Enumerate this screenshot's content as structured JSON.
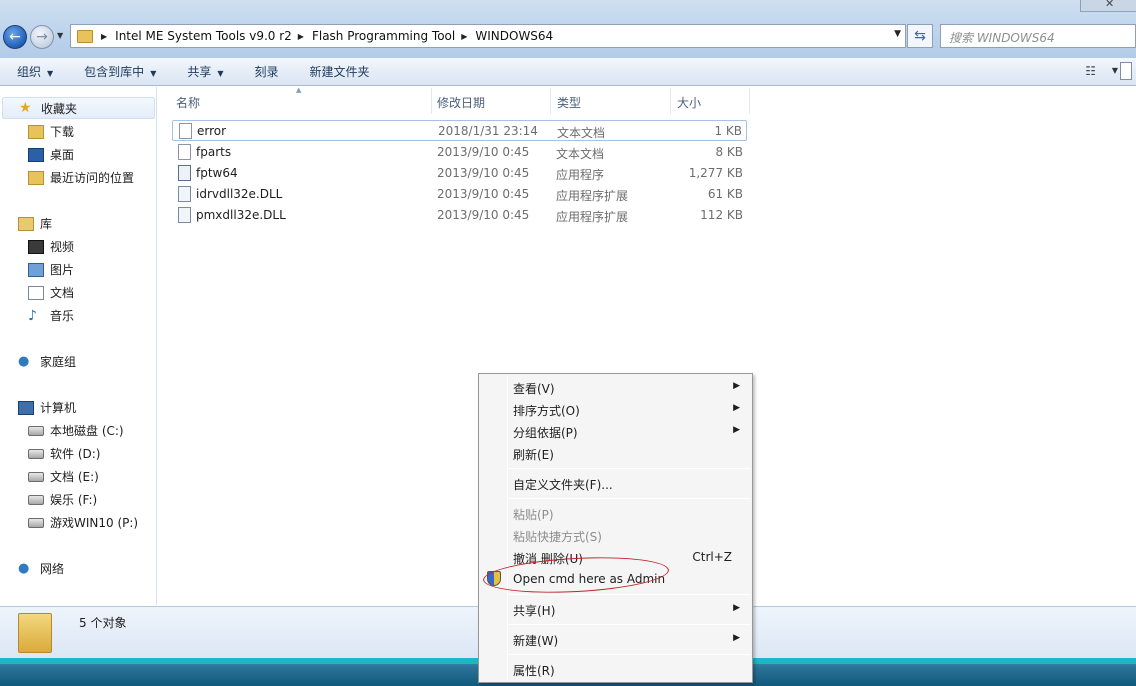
{
  "address": {
    "crumbs": [
      "Intel ME System Tools v9.0 r2",
      "Flash Programming Tool",
      "WINDOWS64"
    ],
    "search_placeholder": "搜索 WINDOWS64"
  },
  "toolbar": {
    "organize": "组织",
    "include_library": "包含到库中",
    "share": "共享",
    "burn": "刻录",
    "new_folder": "新建文件夹"
  },
  "sidebar": {
    "favorites": "收藏夹",
    "downloads": "下载",
    "desktop": "桌面",
    "recent": "最近访问的位置",
    "libraries": "库",
    "videos": "视频",
    "pictures": "图片",
    "documents": "文档",
    "music": "音乐",
    "homegroup": "家庭组",
    "computer": "计算机",
    "drive_c": "本地磁盘 (C:)",
    "drive_d": "软件 (D:)",
    "drive_e": "文档 (E:)",
    "drive_f": "娱乐 (F:)",
    "drive_p": "游戏WIN10 (P:)",
    "network": "网络"
  },
  "columns": {
    "name": "名称",
    "modified": "修改日期",
    "type": "类型",
    "size": "大小"
  },
  "files": [
    {
      "name": "error",
      "date": "2018/1/31 23:14",
      "type": "文本文档",
      "size": "1 KB"
    },
    {
      "name": "fparts",
      "date": "2013/9/10 0:45",
      "type": "文本文档",
      "size": "8 KB"
    },
    {
      "name": "fptw64",
      "date": "2013/9/10 0:45",
      "type": "应用程序",
      "size": "1,277 KB"
    },
    {
      "name": "idrvdll32e.DLL",
      "date": "2013/9/10 0:45",
      "type": "应用程序扩展",
      "size": "61 KB"
    },
    {
      "name": "pmxdll32e.DLL",
      "date": "2013/9/10 0:45",
      "type": "应用程序扩展",
      "size": "112 KB"
    }
  ],
  "status": {
    "count": "5 个对象"
  },
  "context_menu": {
    "view": "查看(V)",
    "sort_by": "排序方式(O)",
    "group_by": "分组依据(P)",
    "refresh": "刷新(E)",
    "customize": "自定义文件夹(F)...",
    "paste": "粘贴(P)",
    "paste_shortcut": "粘贴快捷方式(S)",
    "undo_delete": "撤消 删除(U)",
    "undo_shortcut": "Ctrl+Z",
    "open_cmd": "Open cmd here as Admin",
    "share": "共享(H)",
    "new": "新建(W)",
    "properties": "属性(R)"
  }
}
